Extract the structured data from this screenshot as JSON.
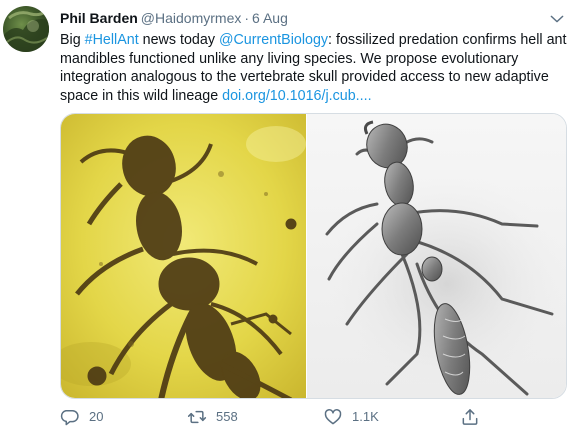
{
  "tweet": {
    "author_name": "Phil Barden",
    "author_handle": "@Haidomyrmex",
    "separator": "·",
    "date": "6 Aug",
    "text": {
      "prefix": "Big ",
      "hashtag": "#HellAnt",
      "part2": " news today ",
      "mention": "@CurrentBiology",
      "part3": ": fossilized predation confirms hell ant mandibles functioned unlike any living species. We propose evolutionary integration analogous to the vertebrate skull provided access to new adaptive space in this wild lineage ",
      "link": "doi.org/10.1016/j.cub...."
    },
    "icons": {
      "more": "chevron-down-icon",
      "reply": "reply-icon",
      "retweet": "retweet-icon",
      "like": "heart-icon",
      "share": "share-icon"
    },
    "counts": {
      "replies": "20",
      "retweets": "558",
      "likes": "1.1K"
    },
    "colors": {
      "link": "#1b95e0",
      "secondary_text": "#5b7083",
      "amber": "#e6d84a"
    }
  }
}
